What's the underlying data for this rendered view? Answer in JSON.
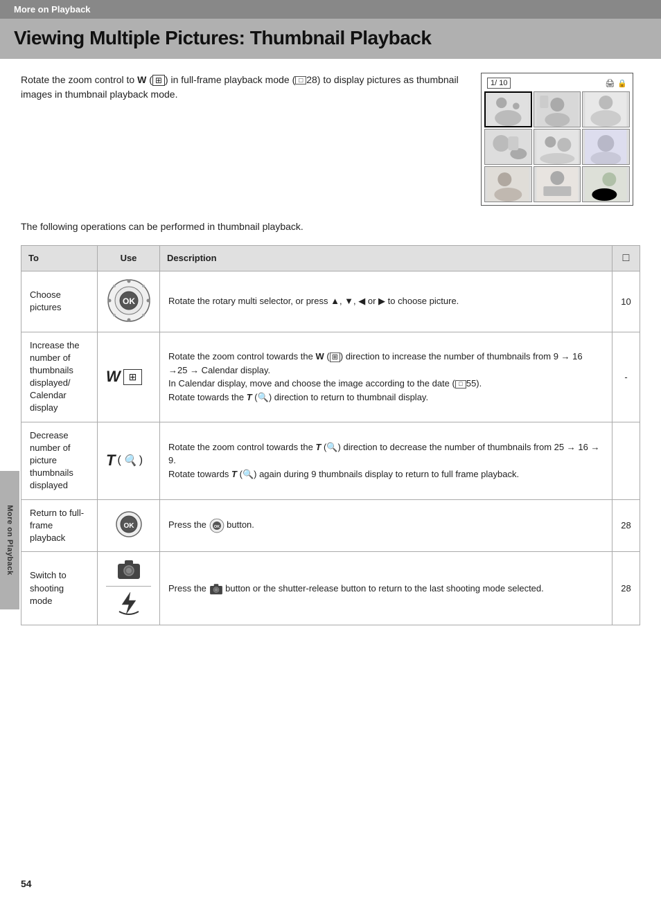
{
  "header": {
    "section": "More on Playback"
  },
  "title": "Viewing Multiple Pictures: Thumbnail Playback",
  "intro": {
    "text1": "Rotate the zoom control to ",
    "bold_w": "W",
    "text2": " (",
    "text3": ") in full-frame playback mode (",
    "ref1": "28",
    "text4": ") to display pictures as thumbnail images in thumbnail playback mode.",
    "camera_status": "1/ 10"
  },
  "following": "The following operations can be performed in thumbnail playback.",
  "table": {
    "headers": {
      "to": "To",
      "use": "Use",
      "description": "Description",
      "page": "📖"
    },
    "rows": [
      {
        "to": "Choose pictures",
        "use": "rotary_ok",
        "description": "Rotate the rotary multi selector, or press ▲, ▼, ◀ or ▶ to choose picture.",
        "page": "10"
      },
      {
        "to": "Increase the number of thumbnails displayed/ Calendar display",
        "use": "w_zoom",
        "description_parts": [
          "Rotate the zoom control towards the W (⊞) direction to increase the number of thumbnails from 9 → 16 →25 → Calendar display.",
          "In Calendar display, move and choose the image according to the date (□□55).",
          "Rotate towards the T (🔍) direction to return to thumbnail display."
        ],
        "page": "-"
      },
      {
        "to": "Decrease number of picture thumbnails displayed",
        "use": "t_zoom",
        "description_parts": [
          "Rotate the zoom control towards the T (🔍) direction to decrease the number of thumbnails from 25 → 16 → 9.",
          "Rotate towards T (🔍) again during 9 thumbnails display to return to full frame playback."
        ],
        "page": ""
      },
      {
        "to": "Return to full-frame playback",
        "use": "ok_button",
        "description": "Press the ⊙ button.",
        "page": "28"
      },
      {
        "to": "Switch to shooting mode",
        "use": "camera_shutter",
        "description": "Press the 📷 button or the shutter-release button to return to the last shooting mode selected.",
        "page": "28"
      }
    ]
  },
  "sidebar_label": "More on Playback",
  "page_number": "54"
}
